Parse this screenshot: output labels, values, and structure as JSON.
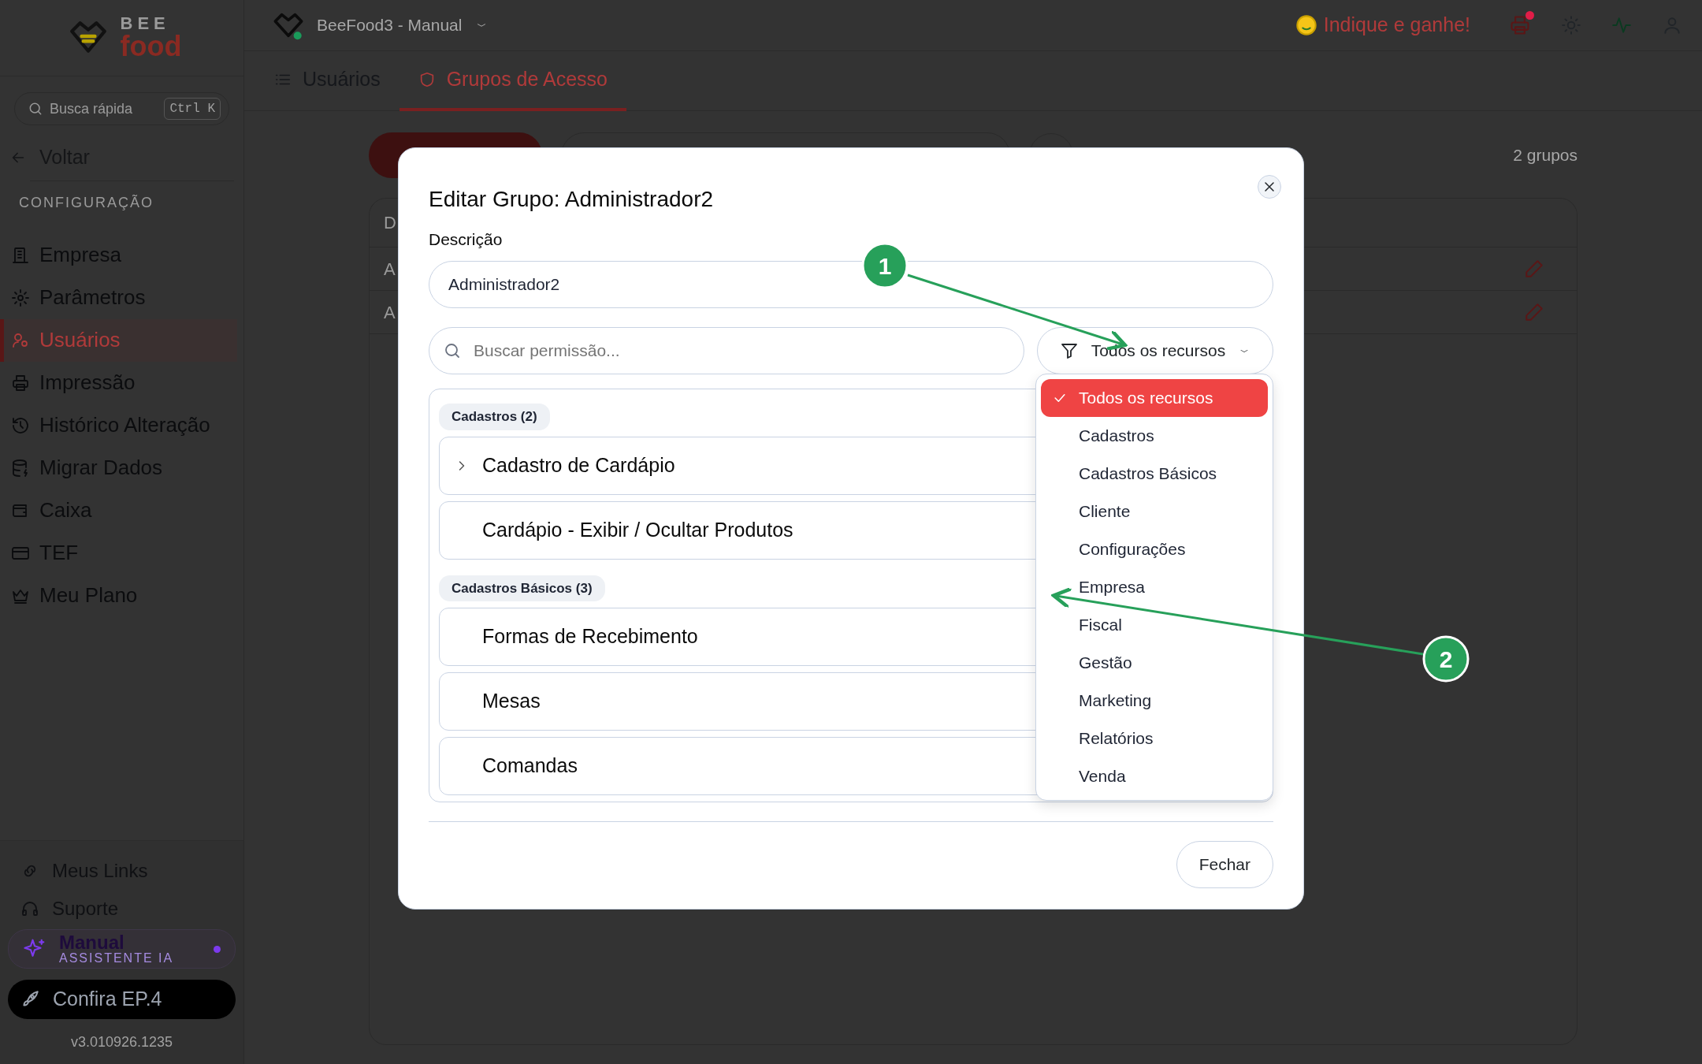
{
  "sidebar": {
    "logo": {
      "line_1": "BEE",
      "line_2": "food"
    },
    "search": {
      "placeholder": "Busca rápida",
      "shortcut": "Ctrl K"
    },
    "back": "Voltar",
    "section": "CONFIGURAÇÃO",
    "items": [
      {
        "label": "Empresa",
        "selected": false
      },
      {
        "label": "Parâmetros",
        "selected": false
      },
      {
        "label": "Usuários",
        "selected": true
      },
      {
        "label": "Impressão",
        "selected": false
      },
      {
        "label": "Histórico Alteração",
        "selected": false
      },
      {
        "label": "Migrar Dados",
        "selected": false
      },
      {
        "label": "Caixa",
        "selected": false
      },
      {
        "label": "TEF",
        "selected": false
      },
      {
        "label": "Meu Plano",
        "selected": false
      }
    ],
    "footer_links": [
      "Meus Links",
      "Suporte"
    ],
    "assistant": {
      "title": "Manual",
      "subtitle": "ASSISTENTE IA"
    },
    "promo": "Confira EP.4",
    "version": "v3.010926.1235"
  },
  "header": {
    "workspace": "BeeFood3 - Manual",
    "referral": "Indique e ganhe!",
    "printer_notification": true
  },
  "tabs": [
    {
      "label": "Usuários",
      "selected": false
    },
    {
      "label": "Grupos de Acesso",
      "selected": true
    }
  ],
  "content": {
    "count": "2 grupos",
    "table": {
      "columns": [
        "D"
      ],
      "rows": [
        [
          "A"
        ],
        [
          "A"
        ]
      ]
    }
  },
  "modal": {
    "title": "Editar Grupo: Administrador2",
    "description_label": "Descrição",
    "description_value": "Administrador2",
    "search": {
      "placeholder": "Buscar permissão..."
    },
    "filter": {
      "value": "Todos os recursos",
      "expanded": true
    },
    "groups": [
      {
        "label": "Cadastros (2)",
        "items": [
          {
            "label": "Cadastro de Cardápio",
            "expandable": true
          },
          {
            "label": "Cardápio - Exibir / Ocultar Produtos",
            "expandable": false
          }
        ]
      },
      {
        "label": "Cadastros Básicos (3)",
        "items": [
          {
            "label": "Formas de Recebimento",
            "expandable": false
          },
          {
            "label": "Mesas",
            "expandable": false
          },
          {
            "label": "Comandas",
            "expandable": false
          }
        ]
      }
    ],
    "filter_options": [
      {
        "label": "Todos os recursos",
        "selected": true
      },
      {
        "label": "Cadastros",
        "selected": false
      },
      {
        "label": "Cadastros Básicos",
        "selected": false
      },
      {
        "label": "Cliente",
        "selected": false
      },
      {
        "label": "Configurações",
        "selected": false
      },
      {
        "label": "Empresa",
        "selected": false
      },
      {
        "label": "Fiscal",
        "selected": false
      },
      {
        "label": "Gestão",
        "selected": false
      },
      {
        "label": "Marketing",
        "selected": false
      },
      {
        "label": "Relatórios",
        "selected": false
      },
      {
        "label": "Venda",
        "selected": false
      }
    ],
    "close_button": "Fechar"
  },
  "annotations": [
    {
      "label": "1"
    },
    {
      "label": "2"
    }
  ]
}
